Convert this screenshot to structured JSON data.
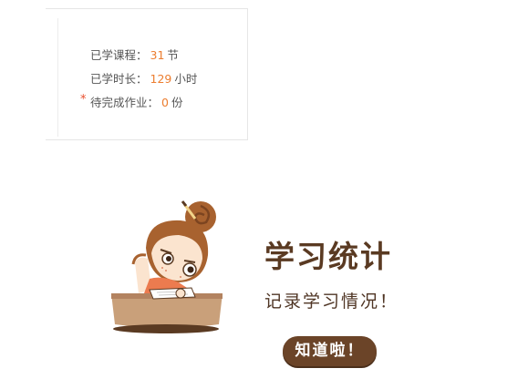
{
  "stats": {
    "rows": [
      {
        "label": "已学课程：",
        "value": "31",
        "unit": "节"
      },
      {
        "label": "已学时长：",
        "value": "129",
        "unit": "小时"
      },
      {
        "label": "待完成作业：",
        "value": "0",
        "unit": "份",
        "required_mark": "*"
      }
    ]
  },
  "promo": {
    "title": "学习统计",
    "subtitle": "记录学习情况！",
    "button_label": "知道啦！"
  },
  "colors": {
    "accent": "#ec7d2f",
    "brown": "#6b4428",
    "required": "#e94e2d"
  },
  "icons": {
    "illustration": "girl-studying-illustration"
  }
}
